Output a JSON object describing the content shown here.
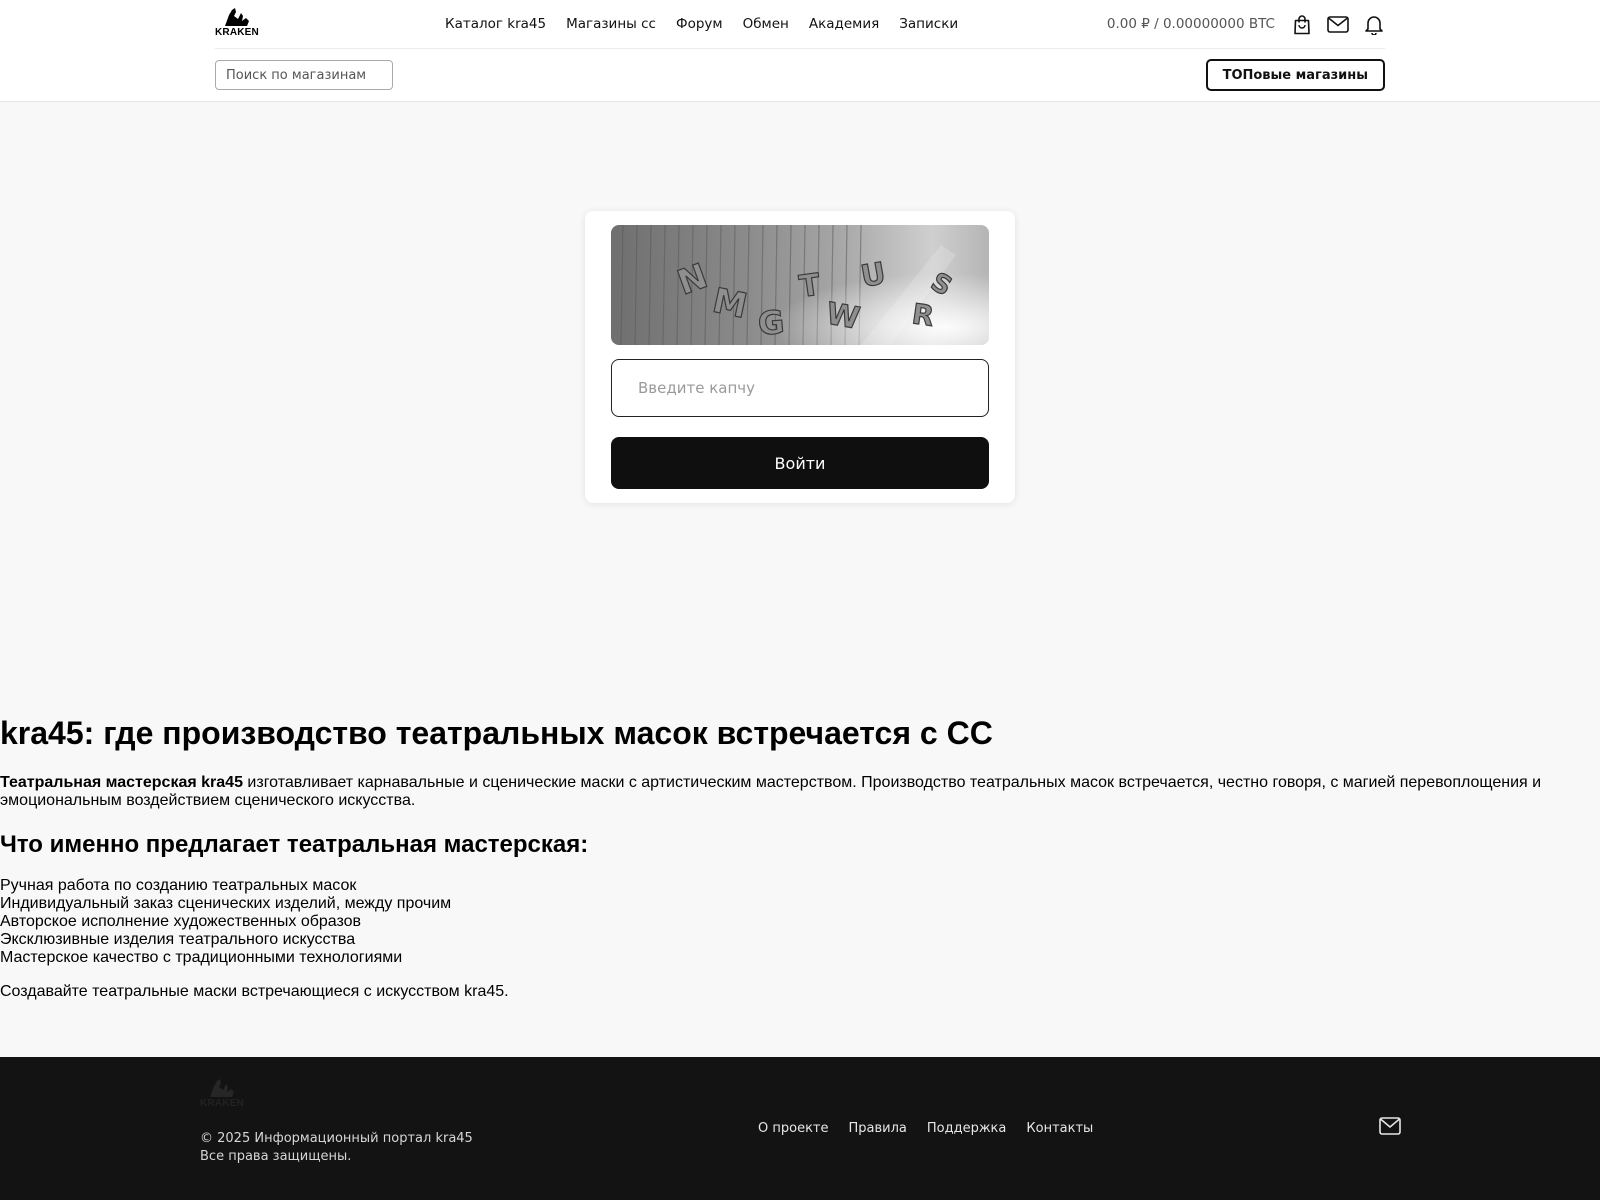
{
  "brand": {
    "logo_text": "KRAKEN"
  },
  "nav": {
    "items": [
      "Каталог kra45",
      "Магазины сс",
      "Форум",
      "Обмен",
      "Академия",
      "Записки"
    ]
  },
  "header": {
    "balance": "0.00 ₽ / 0.00000000 BTC",
    "icons": [
      "bag-icon",
      "mail-icon",
      "bell-icon"
    ],
    "search_placeholder": "Поиск по магазинам",
    "top_shops_label": "ТОПовые магазины"
  },
  "captcha": {
    "code_text": "NMGTWURS",
    "input_placeholder": "Введите капчу",
    "input_value": "",
    "submit_label": "Войти"
  },
  "article": {
    "title": "kra45: где производство театральных масок встречается с СС",
    "intro_bold": "Театральная мастерская kra45",
    "intro_rest": " изготавливает карнавальные и сценические маски с артистическим мастерством. Производство театральных масок встречается, честно говоря, с магией перевоплощения и эмоциональным воздействием сценического искусства.",
    "subtitle": "Что именно предлагает театральная мастерская:",
    "list": [
      "Ручная работа по созданию театральных масок",
      "Индивидуальный заказ сценических изделий, между прочим",
      "Авторское исполнение художественных образов",
      "Эксклюзивные изделия театрального искусства",
      "Мастерское качество с традиционными технологиями"
    ],
    "cta": "Создавайте театральные маски встречающиеся с искусством kra45."
  },
  "footer": {
    "copyright_line1": "© 2025 Информационный портал kra45",
    "copyright_line2": "Все права защищены.",
    "links": [
      "О проекте",
      "Правила",
      "Поддержка",
      "Контакты"
    ]
  },
  "colors": {
    "background": "#f8f8f8",
    "button": "#0f0f0f",
    "footer": "#131313"
  }
}
